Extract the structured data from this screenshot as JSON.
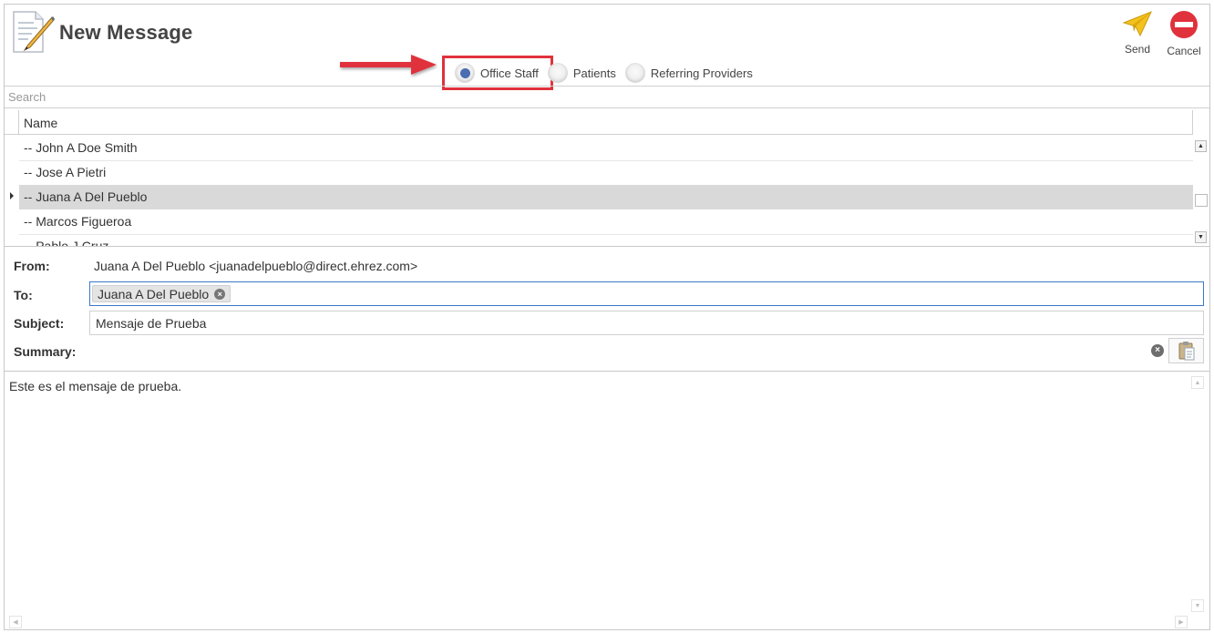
{
  "header": {
    "title": "New Message",
    "send_label": "Send",
    "cancel_label": "Cancel",
    "accent_send": "#f4c21f",
    "accent_cancel": "#e0323c"
  },
  "recipient_types": {
    "options": [
      {
        "label": "Office Staff",
        "selected": true
      },
      {
        "label": "Patients",
        "selected": false
      },
      {
        "label": "Referring Providers",
        "selected": false
      }
    ]
  },
  "search": {
    "placeholder": "Search"
  },
  "grid": {
    "column_header": "Name",
    "rows": [
      {
        "name": "-- John A Doe Smith",
        "selected": false
      },
      {
        "name": "-- Jose A Pietri",
        "selected": false
      },
      {
        "name": "-- Juana A Del Pueblo",
        "selected": true
      },
      {
        "name": "-- Marcos Figueroa",
        "selected": false
      },
      {
        "name": "-- Pablo J Cruz",
        "selected": false
      }
    ]
  },
  "form": {
    "from_label": "From:",
    "from_value": "Juana A Del Pueblo <juanadelpueblo@direct.ehrez.com>",
    "to_label": "To:",
    "to_token": "Juana A Del Pueblo",
    "subject_label": "Subject:",
    "subject_value": "Mensaje de Prueba",
    "summary_label": "Summary:"
  },
  "message_body": {
    "text": "Este es el mensaje de prueba."
  },
  "icons": {
    "app": "note-pencil-icon",
    "send": "paper-plane-icon",
    "cancel": "no-entry-icon",
    "token_remove": "close-circle-icon",
    "clear": "close-circle-icon",
    "paste": "clipboard-icon"
  }
}
